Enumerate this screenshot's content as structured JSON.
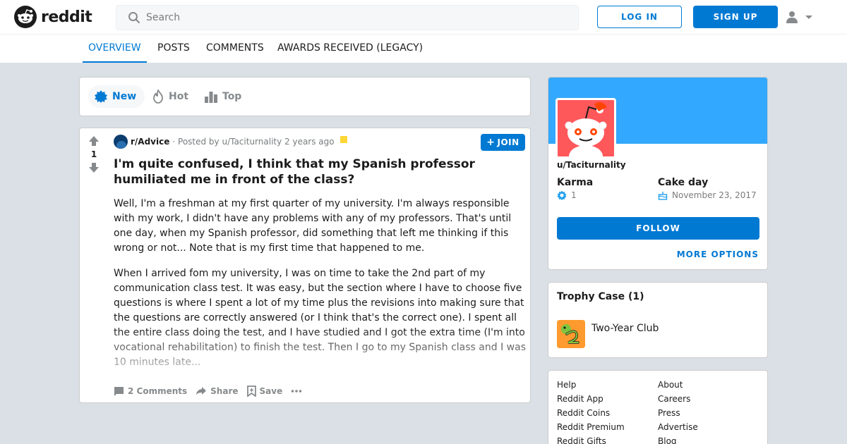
{
  "header": {
    "logo_text": "reddit",
    "search_placeholder": "Search",
    "login_label": "LOG IN",
    "signup_label": "SIGN UP"
  },
  "tabs": [
    {
      "label": "OVERVIEW",
      "active": true
    },
    {
      "label": "POSTS"
    },
    {
      "label": "COMMENTS"
    },
    {
      "label": "AWARDS RECEIVED (LEGACY)"
    }
  ],
  "sort": {
    "new_label": "New",
    "hot_label": "Hot",
    "top_label": "Top"
  },
  "post": {
    "vote_count": "1",
    "subreddit": "r/Advice",
    "posted_by": "· Posted by u/Taciturnality 2 years ago",
    "join_label": "JOIN",
    "title": "I'm quite confused, I think that my Spanish professor humiliated me in front of the class?",
    "body": [
      "Well, I'm a freshman at my first quarter of my university. I'm always responsible with my work, I didn't have any problems with any of my professors. That's until one day, when my Spanish professor, did something that left me thinking if this wrong or not... Note that is my first time that happened to me.",
      "When I arrived fom my university, I was on time to take the 2nd part of my communication class test. It was easy, but the section where I have to choose five questions is where I spent a lot of my time plus the revisions into making sure that the questions are correctly answered (or I think that's the correct one). I spent all the entire class doing the test, and I have studied and I got the extra time (I'm into vocational rehabilitation) to finish the test. Then I go to my Spanish class and I was 10 minutes late..."
    ],
    "comments_label": "2 Comments",
    "share_label": "Share",
    "save_label": "Save"
  },
  "profile": {
    "username": "u/Taciturnality",
    "karma_label": "Karma",
    "karma_value": "1",
    "cakeday_label": "Cake day",
    "cakeday_value": "November 23, 2017",
    "follow_label": "FOLLOW",
    "more_options_label": "MORE OPTIONS"
  },
  "trophies": {
    "title": "Trophy Case (1)",
    "items": [
      {
        "name": "Two-Year Club"
      }
    ]
  },
  "footer_links": {
    "left": [
      "Help",
      "Reddit App",
      "Reddit Coins",
      "Reddit Premium",
      "Reddit Gifts"
    ],
    "right": [
      "About",
      "Careers",
      "Press",
      "Advertise",
      "Blog"
    ]
  },
  "colors": {
    "accent": "#0079d3",
    "banner": "#33a8ff",
    "avatar_bg": "#ff585b",
    "page_bg": "#dae0e6"
  }
}
